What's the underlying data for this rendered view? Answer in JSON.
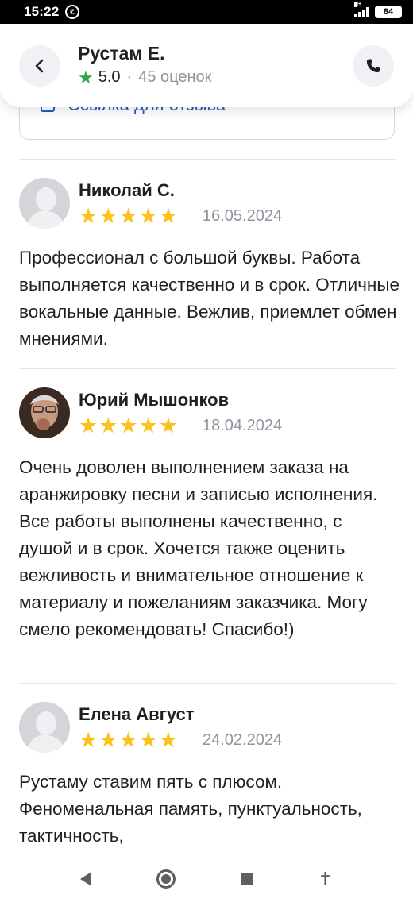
{
  "status_bar": {
    "time": "15:22",
    "battery": "84",
    "network": "H+"
  },
  "header": {
    "name": "Рустам Е.",
    "score": "5.0",
    "separator": "·",
    "review_count": "45 оценок"
  },
  "link_card": {
    "label": "Ссылка для отзыва"
  },
  "reviews": [
    {
      "name": "Николай С.",
      "date": "16.05.2024",
      "stars": 5,
      "text": "Профессионал с большой буквы. Работа выполняется качественно и в срок. Отличные вокальные данные. Вежлив, приемлет обмен мнениями."
    },
    {
      "name": "Юрий Мышонков",
      "date": "18.04.2024",
      "stars": 5,
      "text": "Очень доволен выполнением заказа на аранжировку песни и записью исполнения. Все работы выполнены качественно, с душой и в срок. Хочется также оценить вежливость и внимательное отношение к материалу и пожеланиям заказчика. Могу смело рекомендовать! Спасибо!)"
    },
    {
      "name": "Елена Август",
      "date": "24.02.2024",
      "stars": 5,
      "text": "Рустаму ставим пять с плюсом. Феноменальная память, пунктуальность, тактичность,"
    }
  ],
  "colors": {
    "star": "#fcc21b",
    "rating_star": "#2fa24a",
    "muted": "#8f949e",
    "link": "#2557c9"
  }
}
